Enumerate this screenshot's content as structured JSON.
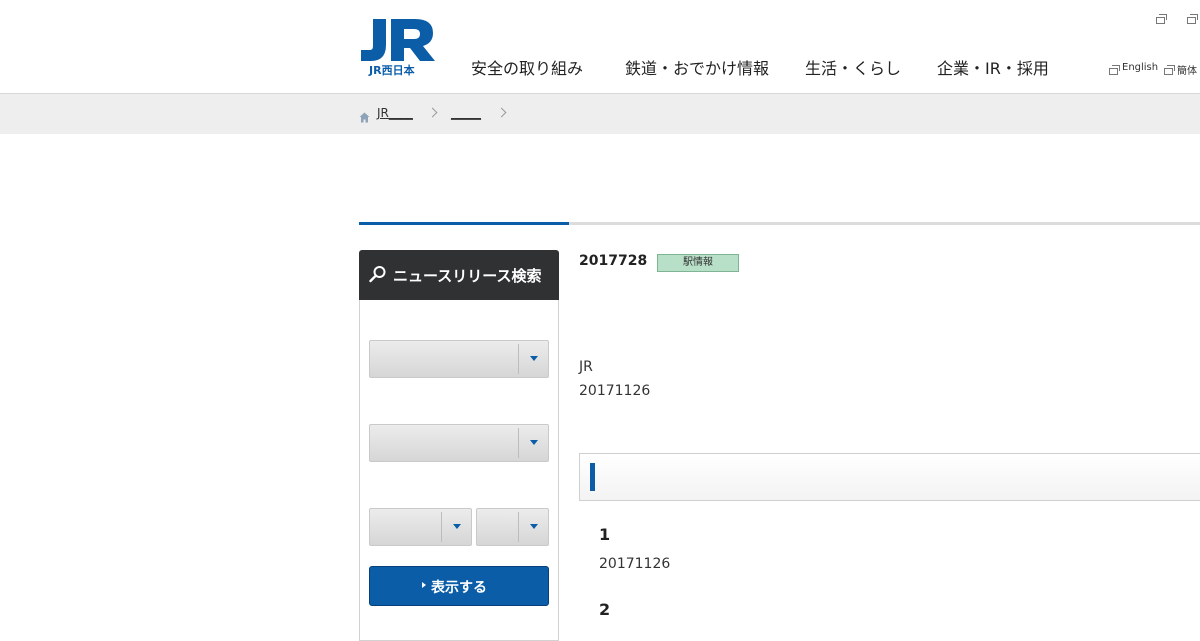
{
  "header": {
    "logo_caption": "JR西日本",
    "nav": [
      "安全の取り組み",
      "鉄道・おでかけ情報",
      "生活・くらし",
      "企業・IR・採用"
    ],
    "utility": {
      "english": "English",
      "second": "簡体"
    }
  },
  "breadcrumb": {
    "items": [
      "JR____",
      "_____"
    ]
  },
  "sidebar": {
    "title": "ニュースリリース検索",
    "submit_label": "表示する"
  },
  "main": {
    "date": "2017728",
    "tag": "駅情報",
    "lines": [
      "JR",
      "20171126"
    ],
    "items": [
      {
        "number": "1",
        "text": "20171126"
      },
      {
        "number": "2",
        "text": ""
      }
    ]
  },
  "colors": {
    "brand_blue": "#0b5da8",
    "sidebar_head": "#2f3133",
    "tag_green": "#b8e0c9"
  }
}
